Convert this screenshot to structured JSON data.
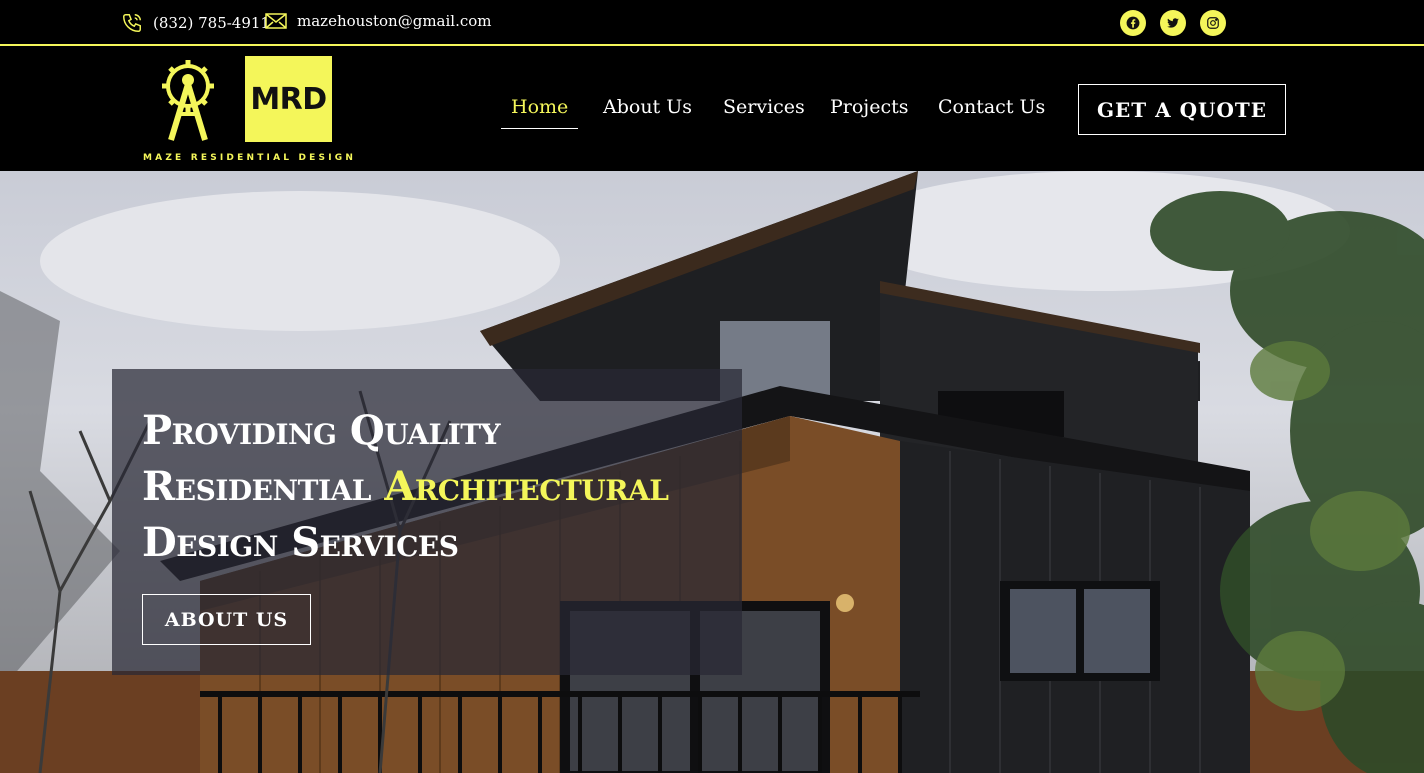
{
  "topbar": {
    "phone": "(832) 785-4911",
    "email": "mazehouston@gmail.com",
    "social_icons": [
      "facebook-icon",
      "twitter-icon",
      "instagram-icon"
    ]
  },
  "logo": {
    "mark_text": "MRD",
    "tagline": "MAZE RESIDENTIAL DESIGN"
  },
  "nav": {
    "items": [
      {
        "label": "Home",
        "active": true
      },
      {
        "label": "About Us",
        "active": false
      },
      {
        "label": "Services",
        "active": false
      },
      {
        "label": "Projects",
        "active": false
      },
      {
        "label": "Contact Us",
        "active": false
      }
    ],
    "cta_label": "GET A QUOTE"
  },
  "hero": {
    "headline_line1": "Providing Quality",
    "headline_line2_plain": "Residential ",
    "headline_line2_accent": "Architectural",
    "headline_line3": "Design Services",
    "button_label": "ABOUT US"
  },
  "colors": {
    "accent": "#f4f65a",
    "background": "#000000",
    "text": "#ffffff"
  }
}
